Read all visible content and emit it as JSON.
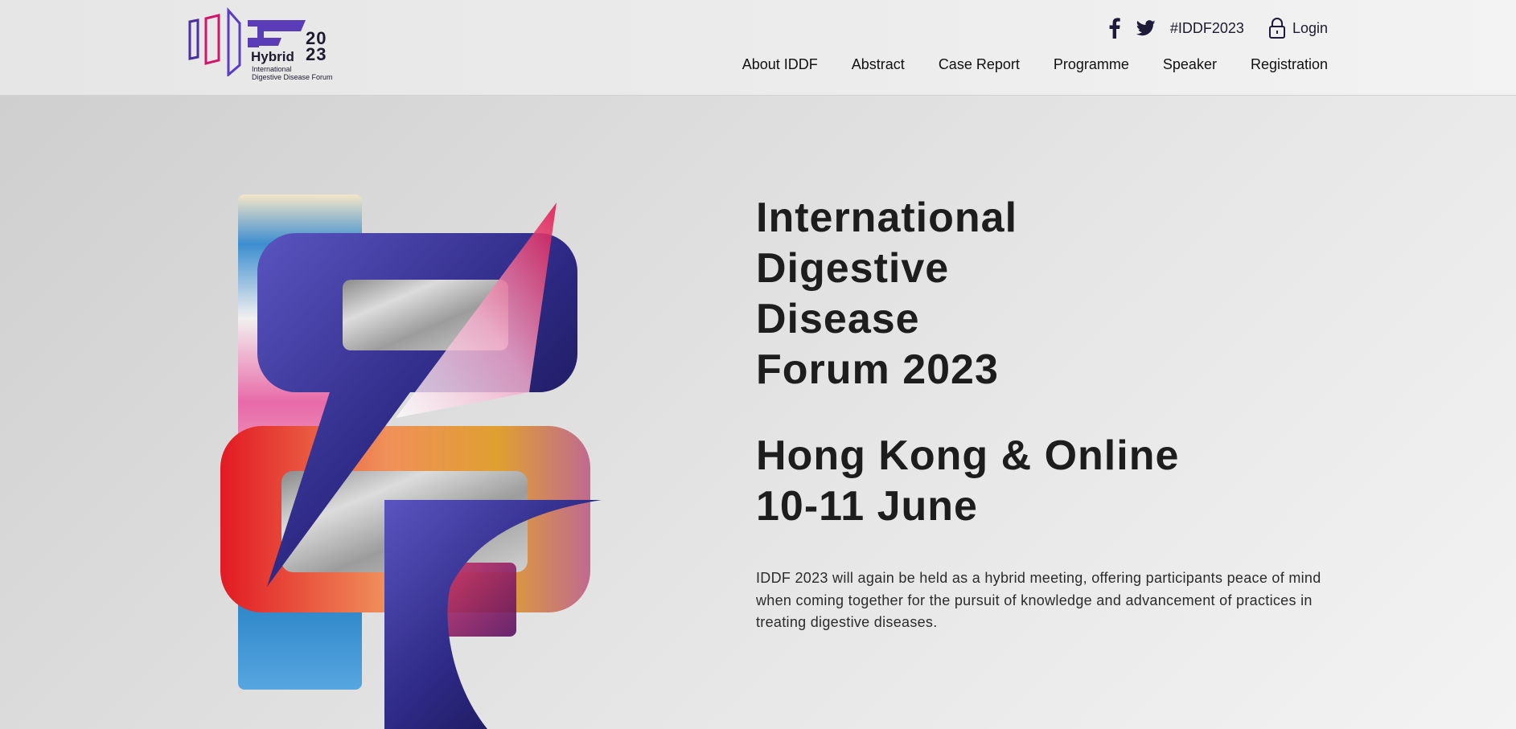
{
  "logo": {
    "year_top": "20",
    "year_bottom": "23",
    "hybrid": "Hybrid",
    "sub_line1": "International",
    "sub_line2": "Digestive Disease Forum"
  },
  "topbar": {
    "facebook_icon": "facebook-icon",
    "twitter_icon": "twitter-icon",
    "hashtag": "#IDDF2023",
    "login_icon": "lock-icon",
    "login": "Login"
  },
  "nav": {
    "items": [
      {
        "label": "About IDDF"
      },
      {
        "label": "Abstract"
      },
      {
        "label": "Case Report"
      },
      {
        "label": "Programme"
      },
      {
        "label": "Speaker"
      },
      {
        "label": "Registration"
      }
    ]
  },
  "hero": {
    "title_lines": [
      "International",
      "Digestive",
      "Disease",
      "Forum 2023"
    ],
    "subtitle_lines": [
      "Hong Kong & Online",
      "10-11 June"
    ],
    "description": "IDDF 2023 will again be held as a hybrid meeting, offering participants peace of mind when coming together for the pursuit of knowledge and advancement of practices in treating digestive diseases."
  },
  "colors": {
    "brand_purple": "#3b2a8a",
    "brand_magenta": "#d0166a",
    "text_dark": "#1d1d1d"
  }
}
